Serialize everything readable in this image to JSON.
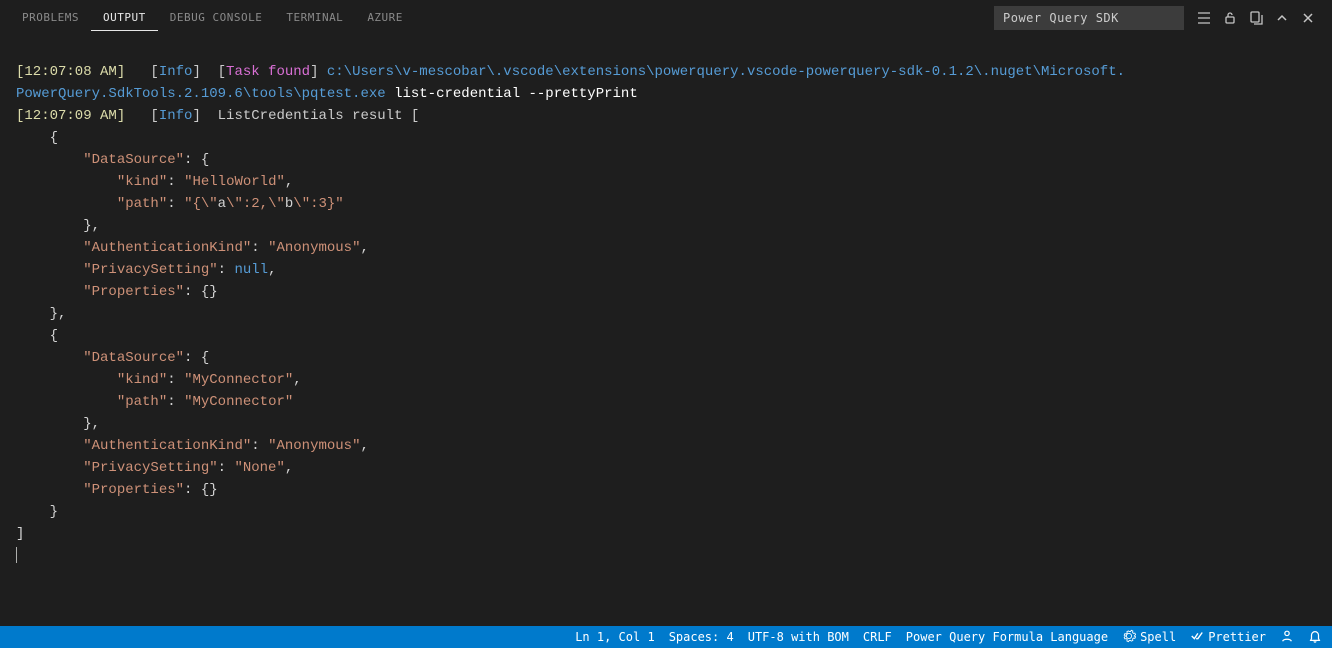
{
  "panel": {
    "tabs": {
      "problems": "PROBLEMS",
      "output": "OUTPUT",
      "debug": "DEBUG CONSOLE",
      "terminal": "TERMINAL",
      "azure": "AZURE"
    },
    "select": "Power Query SDK"
  },
  "log": {
    "ts1": "[12:07:08 AM]",
    "info": "Info",
    "taskfound": "Task found",
    "path1": "c:\\Users\\v-mescobar\\.vscode\\extensions\\powerquery.vscode-powerquery-sdk-0.1.2\\.nuget\\Microsoft.",
    "path2": "PowerQuery.SdkTools.2.109.6\\tools\\pqtest.exe",
    "args": "list-credential --prettyPrint",
    "ts2": "[12:07:09 AM]",
    "result_label": "ListCredentials result [",
    "entry1": {
      "ds_kind_key": "\"kind\"",
      "ds_kind_val": "\"HelloWorld\"",
      "ds_path_key": "\"path\"",
      "ds_path_val_pre": "\"{\\\"",
      "ds_path_a": "a",
      "ds_path_mid1": "\\\":2,\\\"",
      "ds_path_b": "b",
      "ds_path_mid2": "\\\":3}\"",
      "authkind": "\"Anonymous\"",
      "privacy": "null"
    },
    "entry2": {
      "ds_kind_val": "\"MyConnector\"",
      "ds_path_val": "\"MyConnector\"",
      "authkind": "\"Anonymous\"",
      "privacy": "\"None\""
    },
    "keys": {
      "datasource": "\"DataSource\"",
      "kind": "\"kind\"",
      "path": "\"path\"",
      "authkind": "\"AuthenticationKind\"",
      "privacy": "\"PrivacySetting\"",
      "props": "\"Properties\""
    }
  },
  "status": {
    "pos": "Ln 1, Col 1",
    "spaces": "Spaces: 4",
    "enc": "UTF-8 with BOM",
    "eol": "CRLF",
    "lang": "Power Query Formula Language",
    "spell": "Spell",
    "prettier": "Prettier"
  }
}
